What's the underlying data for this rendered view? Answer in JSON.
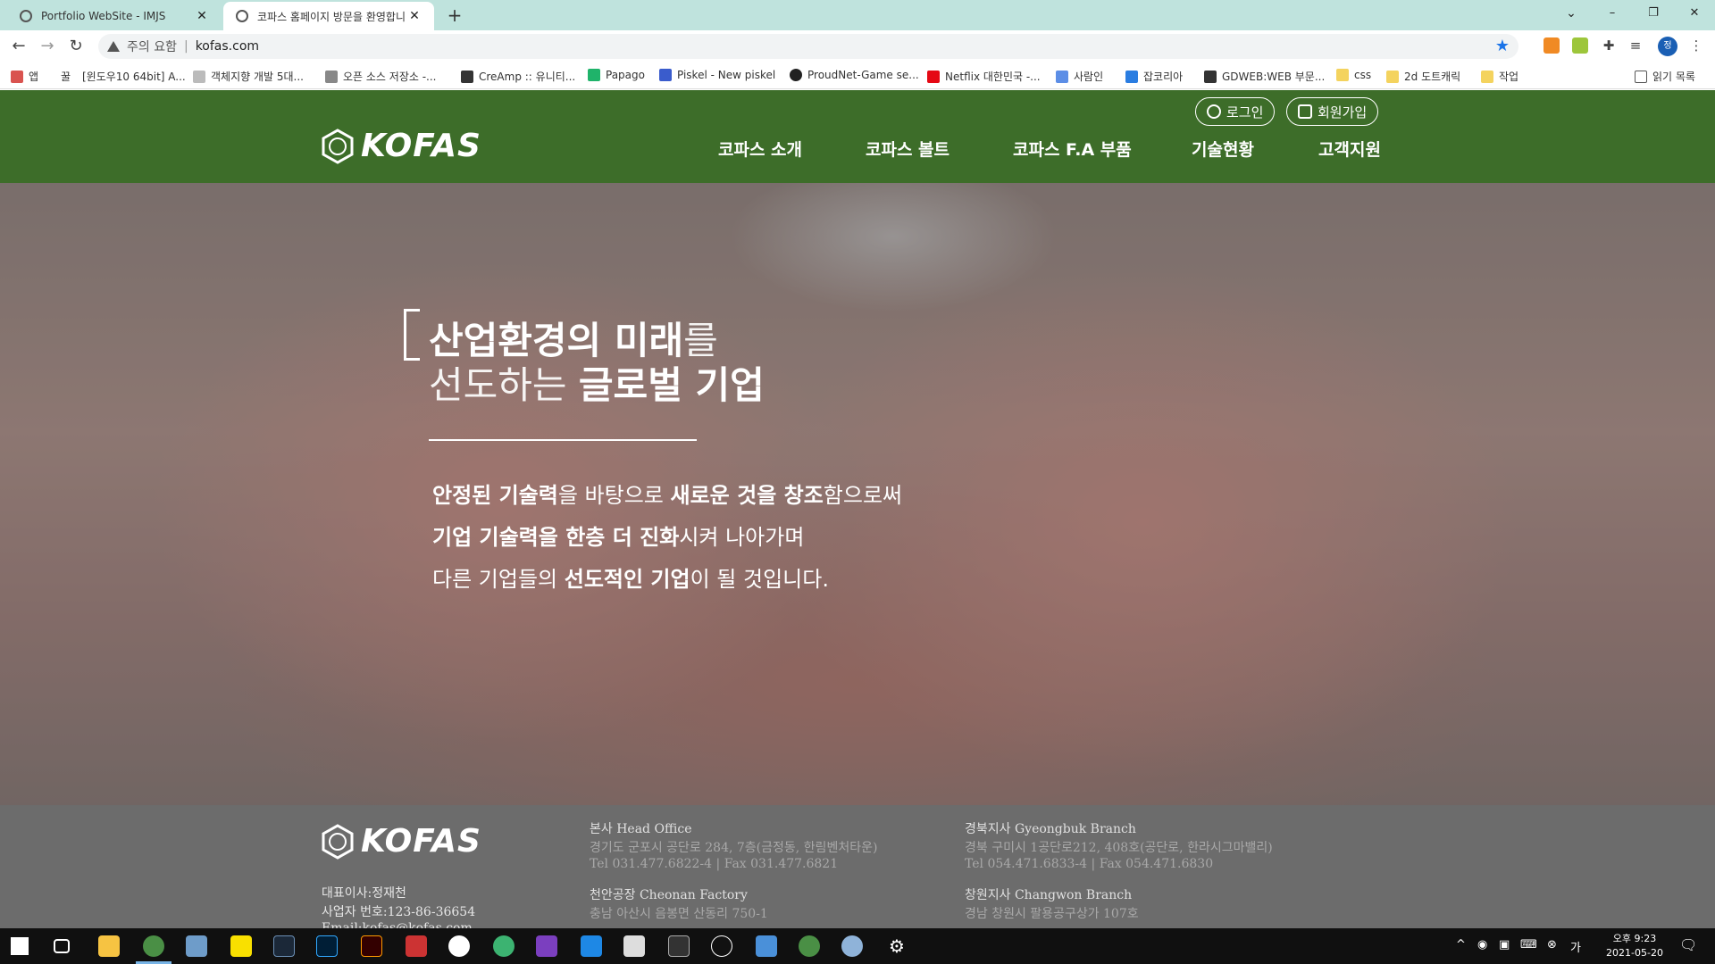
{
  "browser": {
    "tabs": [
      {
        "label": "Portfolio WebSite - IMJS",
        "active": false
      },
      {
        "label": "코파스 홈페이지 방문을 환영합니",
        "active": true
      }
    ],
    "new_tab": "+",
    "window_controls": [
      "–",
      "❐",
      "✕"
    ],
    "address": {
      "security_label": "주의 요함",
      "url": "kofas.com"
    },
    "bookmarks": [
      {
        "label": "앱",
        "icon": "apps-grid-icon"
      },
      {
        "label": "꿀",
        "icon": "bookmark-icon"
      },
      {
        "label": "[윈도우10 64bit] A...",
        "icon": "page-icon"
      },
      {
        "label": "객체지향 개발 5대...",
        "icon": "page-icon"
      },
      {
        "label": "오픈 소스 저장소 -...",
        "icon": "page-icon"
      },
      {
        "label": "CreAmp :: 유니티...",
        "icon": "page-icon"
      },
      {
        "label": "Papago",
        "icon": "papago-icon"
      },
      {
        "label": "Piskel - New piskel",
        "icon": "piskel-icon"
      },
      {
        "label": "ProudNet-Game se...",
        "icon": "page-icon"
      },
      {
        "label": "Netflix 대한민국 -...",
        "icon": "netflix-icon"
      },
      {
        "label": "사람인",
        "icon": "saramin-icon"
      },
      {
        "label": "잡코리아",
        "icon": "jobkorea-icon"
      },
      {
        "label": "GDWEB:WEB 부문...",
        "icon": "page-icon"
      },
      {
        "label": "css",
        "icon": "folder-icon"
      },
      {
        "label": "2d 도트캐릭",
        "icon": "folder-icon"
      },
      {
        "label": "작업",
        "icon": "folder-icon"
      }
    ],
    "reading_list": "읽기 목록",
    "profile_initial": "정"
  },
  "site": {
    "brand": "KOFAS",
    "auth": {
      "login": "로그인",
      "signup": "회원가입"
    },
    "nav": [
      "코파스 소개",
      "코파스 볼트",
      "코파스 F.A 부품",
      "기술현황",
      "고객지원"
    ],
    "hero": {
      "title_line1_bold": "산업환경의 미래",
      "title_line1_light": "를",
      "title_line2_light": "선도하는 ",
      "title_line2_bold": "글로벌 기업",
      "copy_line1": [
        {
          "text": "안정된 기술력",
          "bold": true
        },
        {
          "text": "을 바탕으로 ",
          "bold": false
        },
        {
          "text": "새로운 것을 창조",
          "bold": true
        },
        {
          "text": "함으로써",
          "bold": false
        }
      ],
      "copy_line2": [
        {
          "text": "기업 기술력을 한층 더 진화",
          "bold": true
        },
        {
          "text": "시켜 나아가며",
          "bold": false
        }
      ],
      "copy_line3": [
        {
          "text": "다른 기업들의 ",
          "bold": false
        },
        {
          "text": "선도적인 기업",
          "bold": true
        },
        {
          "text": "이 될 것입니다.",
          "bold": false
        }
      ]
    },
    "footer": {
      "ceo": "대표이사:정재천",
      "biz_no": "사업자 번호:123-86-36654",
      "email": "Email:kofas@kofas.com",
      "offices": [
        {
          "name": "본사 Head Office",
          "addr": "경기도 군포시 공단로 284, 7층(금정동, 한림벤처타운)",
          "tel": "Tel 031.477.6822-4 | Fax 031.477.6821"
        },
        {
          "name": "천안공장 Cheonan Factory",
          "addr": "충남 아산시 음봉면 산동리 750-1"
        },
        {
          "name": "경북지사 Gyeongbuk Branch",
          "addr": "경북 구미시 1공단로212, 408호(공단로, 한라시그마밸리)",
          "tel": "Tel 054.471.6833-4 | Fax 054.471.6830"
        },
        {
          "name": "창원지사 Changwon Branch",
          "addr": "경남 창원시 팔용공구상가 107호"
        }
      ]
    }
  },
  "taskbar": {
    "clock_time": "오후 9:23",
    "clock_date": "2021-05-20"
  },
  "colors": {
    "header_green": "#3d6d29",
    "footer_gray": "#6c6c6c",
    "tabbar_teal": "#bfe3dd"
  }
}
